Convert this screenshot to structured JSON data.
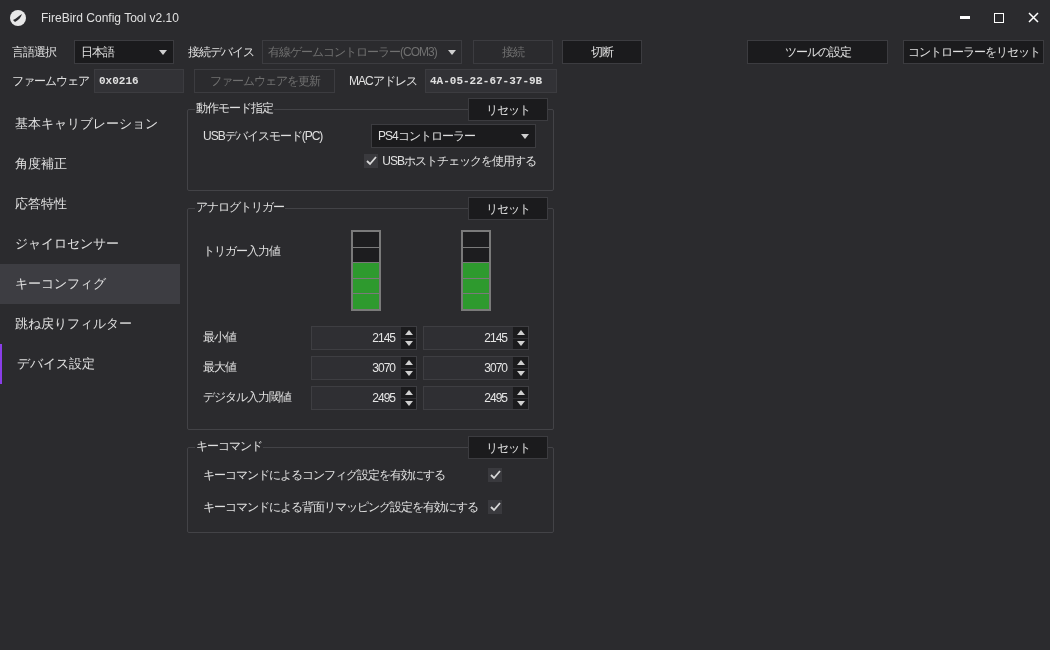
{
  "window": {
    "title": "FireBird Config Tool v2.10"
  },
  "toolbar": {
    "language_label": "言語選択",
    "language": "日本語",
    "device_label": "接続デバイス",
    "device": {
      "value": "有線ゲームコントローラー(COM3)",
      "disabled": true
    },
    "connect_button": {
      "label": "接続",
      "disabled": true
    },
    "disconnect_button": {
      "label": "切断",
      "disabled": false
    },
    "tool_settings_button": "ツールの設定",
    "reset_controller_button": "コントローラーをリセット"
  },
  "firmware": {
    "label": "ファームウェア",
    "value": "0x0216",
    "update_button": {
      "label": "ファームウェアを更新",
      "disabled": true
    },
    "mac_label": "MACアドレス",
    "mac": "4A-05-22-67-37-9B"
  },
  "sidebar": {
    "items": [
      {
        "label": "基本キャリブレーション",
        "selected": false,
        "indicator": false
      },
      {
        "label": "角度補正",
        "selected": false,
        "indicator": false
      },
      {
        "label": "応答特性",
        "selected": false,
        "indicator": false
      },
      {
        "label": "ジャイロセンサー",
        "selected": false,
        "indicator": false
      },
      {
        "label": "キーコンフィグ",
        "selected": true,
        "indicator": false
      },
      {
        "label": "跳ね戻りフィルター",
        "selected": false,
        "indicator": false
      },
      {
        "label": "デバイス設定",
        "selected": false,
        "indicator": true
      }
    ]
  },
  "mode_group": {
    "title": "動作モード指定",
    "reset": "リセット",
    "usb_mode_label": "USBデバイスモード(PC)",
    "usb_mode": "PS4コントローラー",
    "host_check": {
      "label": "USBホストチェックを使用する",
      "checked": true
    }
  },
  "trigger_group": {
    "title": "アナログトリガー",
    "reset": "リセット",
    "input_label": "トリガー入力値",
    "meters": [
      {
        "level": 0.6
      },
      {
        "level": 0.6
      }
    ],
    "rows": [
      {
        "label": "最小値",
        "values": [
          "2145",
          "2145"
        ]
      },
      {
        "label": "最大値",
        "values": [
          "3070",
          "3070"
        ]
      },
      {
        "label": "デジタル入力閾値",
        "values": [
          "2495",
          "2495"
        ]
      }
    ]
  },
  "key_command_group": {
    "title": "キーコマンド",
    "reset": "リセット",
    "options": [
      {
        "label": "キーコマンドによるコンフィグ設定を有効にする",
        "checked": true
      },
      {
        "label": "キーコマンドによる背面リマッピング設定を有効にする",
        "checked": true
      }
    ]
  }
}
